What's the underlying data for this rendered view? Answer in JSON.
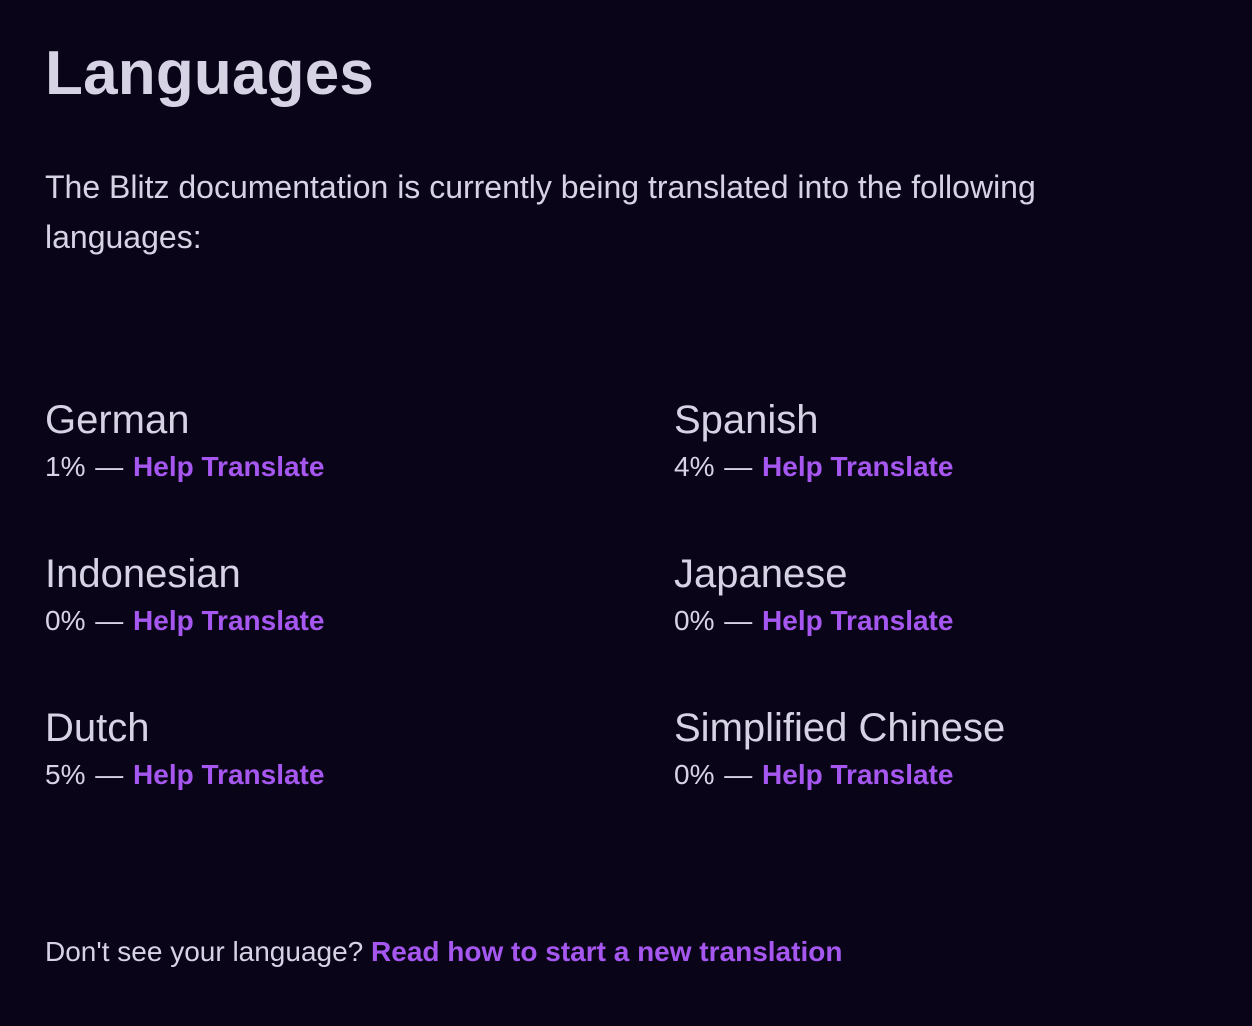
{
  "page": {
    "title": "Languages",
    "intro": "The Blitz documentation is currently being translated into the following languages:"
  },
  "languages": [
    {
      "name": "German",
      "progress": "1%",
      "separator": "—",
      "link_label": "Help Translate"
    },
    {
      "name": "Spanish",
      "progress": "4%",
      "separator": "—",
      "link_label": "Help Translate"
    },
    {
      "name": "Indonesian",
      "progress": "0%",
      "separator": "—",
      "link_label": "Help Translate"
    },
    {
      "name": "Japanese",
      "progress": "0%",
      "separator": "—",
      "link_label": "Help Translate"
    },
    {
      "name": "Dutch",
      "progress": "5%",
      "separator": "—",
      "link_label": "Help Translate"
    },
    {
      "name": "Simplified Chinese",
      "progress": "0%",
      "separator": "—",
      "link_label": "Help Translate"
    }
  ],
  "footer": {
    "prompt": "Don't see your language?",
    "link_label": "Read how to start a new translation"
  },
  "colors": {
    "background": "#0a0419",
    "text": "#d6d4e4",
    "link": "#a557f0"
  }
}
